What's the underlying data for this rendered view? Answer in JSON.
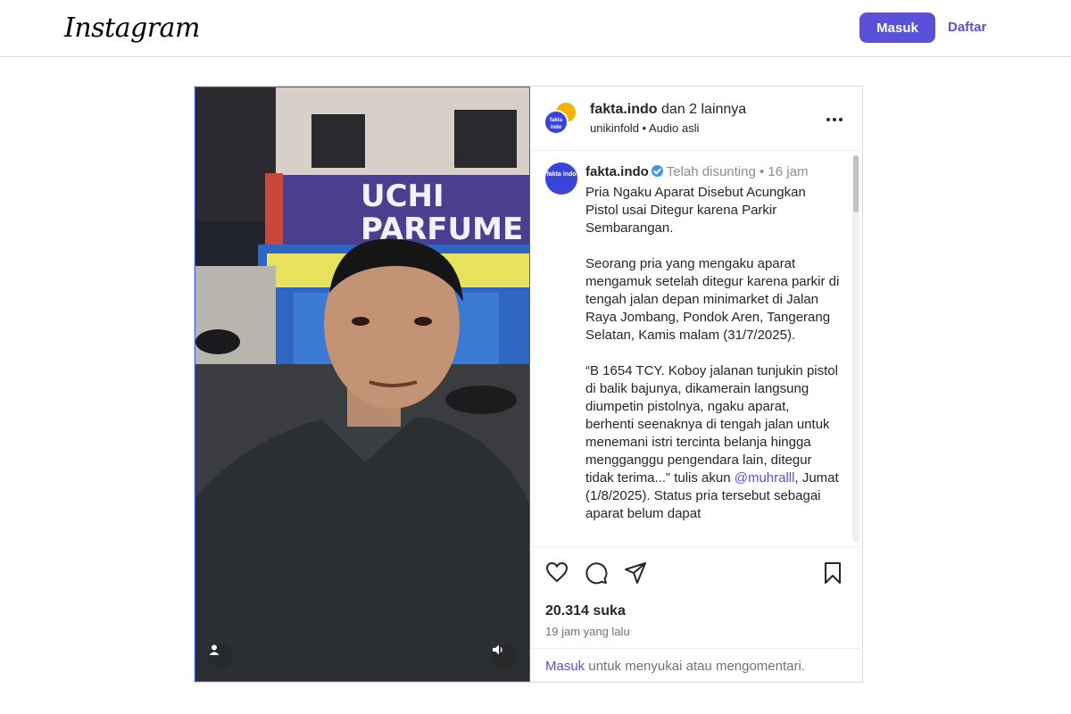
{
  "header": {
    "logo": "Instagram",
    "login_label": "Masuk",
    "register_label": "Daftar"
  },
  "post": {
    "author": "fakta.indo",
    "coauthors": "dan 2 lainnya",
    "subtitle": "unikinfold • Audio asli",
    "avatar_text": "fakta indo",
    "caption": {
      "username": "fakta.indo",
      "edited": "Telah disunting",
      "age": "• 16 jam",
      "paragraph1": "Pria Ngaku Aparat Disebut Acungkan Pistol usai Ditegur karena Parkir Sembarangan.",
      "paragraph2": "Seorang pria yang mengaku aparat mengamuk setelah ditegur karena parkir di tengah jalan depan minimarket di Jalan Raya Jombang, Pondok Aren, Tangerang Selatan, Kamis malam (31/7/2025).",
      "paragraph3_before": "“B 1654 TCY. Koboy jalanan tunjukin pistol di balik bajunya, dikamerain langsung diumpetin pistolnya, ngaku aparat, berhenti seenaknya di tengah jalan untuk menemani istri tercinta belanja hingga mengganggu pengendara lain, ditegur tidak terima...” tulis akun ",
      "mention": "@muhralll",
      "paragraph3_after": ", Jumat (1/8/2025). Status pria tersebut sebagai aparat belum dapat"
    },
    "likes": "20.314 suka",
    "time_ago": "19 jam yang lalu",
    "login_prompt": {
      "link": "Masuk",
      "text": " untuk menyukai atau mengomentari."
    }
  },
  "video": {
    "sign_top": "UCHI",
    "sign_bottom": "PARFUME",
    "sign_lower": "UCHI PARFUME"
  },
  "icons": [
    "heart-icon",
    "comment-icon",
    "share-icon",
    "bookmark-icon",
    "more-icon",
    "user-icon",
    "sound-icon",
    "verified-icon"
  ]
}
